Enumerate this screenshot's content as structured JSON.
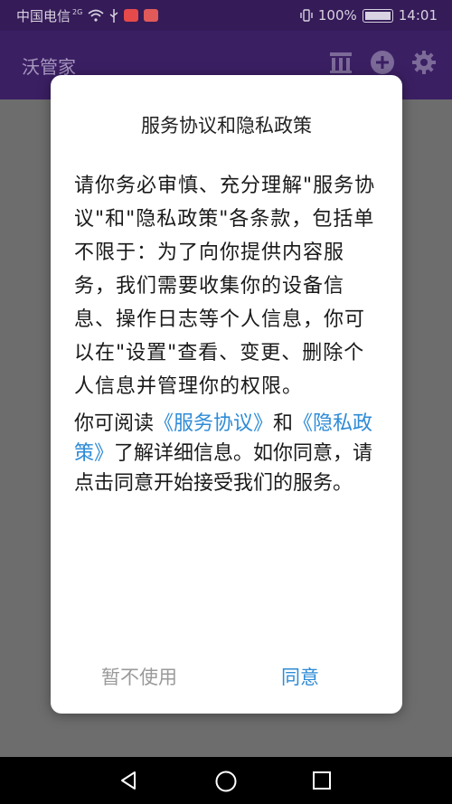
{
  "status_bar": {
    "carrier": "中国电信",
    "network": "2G",
    "battery_percent": "100%",
    "time": "14:01",
    "colors": {
      "background": "#351b57",
      "text": "#d8d2e2"
    }
  },
  "app_bar": {
    "title": "沃管家",
    "actions": [
      "library-icon",
      "add-icon",
      "settings-icon"
    ],
    "colors": {
      "background": "#3b1f63",
      "title": "#a596bd"
    }
  },
  "dialog": {
    "title": "服务协议和隐私政策",
    "paragraph1": "请你务必审慎、充分理解\"服务协议\"和\"隐私政策\"各条款，包括单不限于：为了向你提供内容服务，我们需要收集你的设备信息、操作日志等个人信息，你可以在\"设置\"查看、变更、删除个人信息并管理你的权限。",
    "paragraph2": {
      "prefix": "你可阅读",
      "link_terms": "《服务协议》",
      "middle": "和",
      "link_privacy": "《隐私政策》",
      "suffix": "了解详细信息。如你同意，请点击同意开始接受我们的服务。"
    },
    "decline_label": "暂不使用",
    "agree_label": "同意",
    "colors": {
      "link": "#2e8bd6",
      "decline": "#9a9a9a"
    }
  },
  "nav_bar": {
    "buttons": [
      "back-icon",
      "home-icon",
      "recents-icon"
    ]
  }
}
